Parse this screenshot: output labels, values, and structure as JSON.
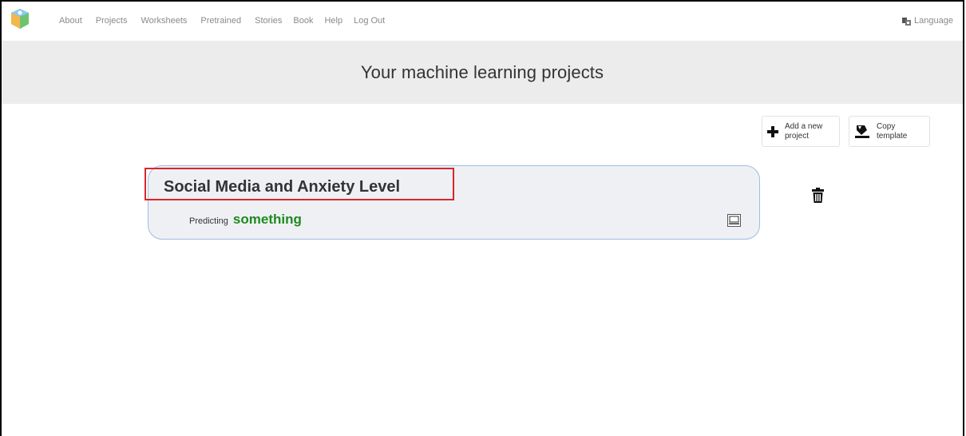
{
  "nav": {
    "items": [
      {
        "label": "About"
      },
      {
        "label": "Projects"
      },
      {
        "label": "Worksheets"
      },
      {
        "label": "Pretrained"
      },
      {
        "label": "Stories"
      },
      {
        "label": "Book"
      },
      {
        "label": "Help"
      },
      {
        "label": "Log Out"
      }
    ],
    "language_label": "Language"
  },
  "banner": {
    "title": "Your machine learning projects"
  },
  "actions": {
    "add_label": "Add a new\nproject",
    "copy_label": "Copy\ntemplate"
  },
  "projects": [
    {
      "title": "Social Media and Anxiety Level",
      "predicting_label": "Predicting",
      "predicting_value": "something"
    }
  ],
  "colors": {
    "banner_bg": "#ececec",
    "card_bg": "#eef0f4",
    "card_border": "#9dbde3",
    "predict_value": "#1e8a1e",
    "highlight": "#d9262b"
  },
  "icons": [
    "logo-icon",
    "language-icon",
    "plus-icon",
    "copy-template-icon",
    "computer-icon",
    "trash-icon"
  ]
}
